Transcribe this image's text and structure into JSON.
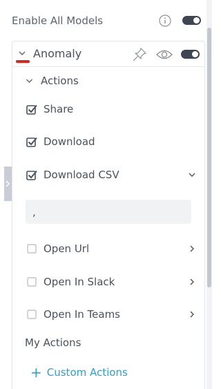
{
  "header": {
    "enable_all_label": "Enable All Models",
    "enable_all_toggle": "on"
  },
  "panel": {
    "title": "Anomaly",
    "toggle_state": "on",
    "accent_color": "#e0241b",
    "actions_section_label": "Actions",
    "actions": [
      {
        "label": "Share",
        "checked": true,
        "has_submenu": false
      },
      {
        "label": "Download",
        "checked": true,
        "has_submenu": false
      },
      {
        "label": "Download CSV",
        "checked": true,
        "has_submenu": true,
        "expanded": true
      },
      {
        "label": "Open Url",
        "checked": false,
        "has_submenu": true
      },
      {
        "label": "Open In Slack",
        "checked": false,
        "has_submenu": true
      },
      {
        "label": "Open In Teams",
        "checked": false,
        "has_submenu": true
      }
    ],
    "csv_delimiter_value": ",",
    "my_actions_label": "My Actions",
    "custom_actions_icon": "+",
    "custom_actions_label": "Custom Actions",
    "link_color": "#2a9fd8"
  },
  "icons": {
    "info": "info-icon",
    "pin": "pin-icon",
    "visibility": "eye-icon",
    "collapse": "chevron-down-icon",
    "expand": "chevron-right-icon"
  }
}
